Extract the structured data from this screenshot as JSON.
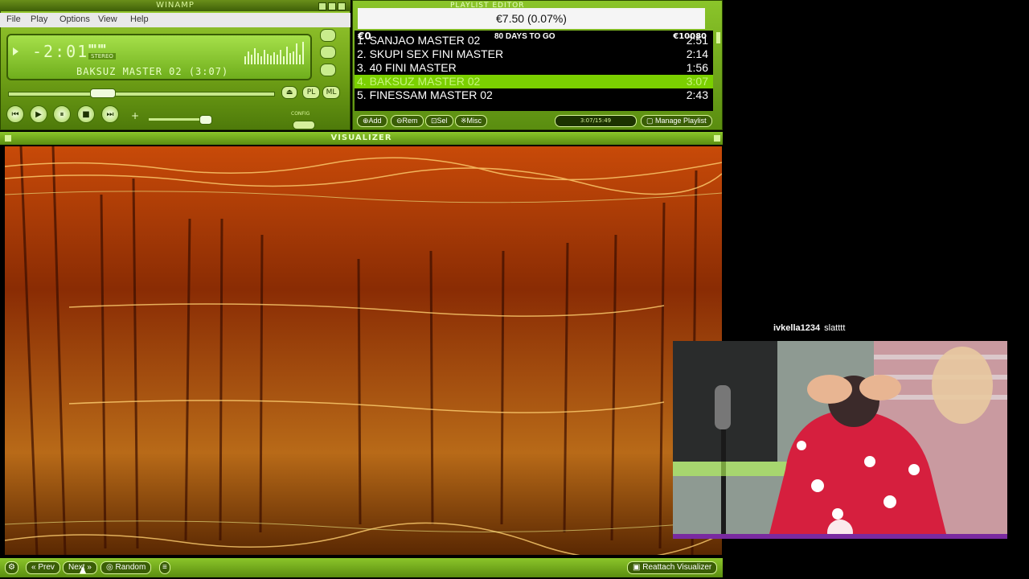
{
  "main_window": {
    "title": "WINAMP",
    "menu": [
      "File",
      "Play",
      "Options",
      "View",
      "Help"
    ],
    "time": "-2:01",
    "stereo": "STEREO",
    "now_playing": "BAKSUZ MASTER 02 (3:07)",
    "buttons": {
      "pl": "PL",
      "ml": "ML",
      "config": "CONFIG"
    }
  },
  "playlist": {
    "title": "PLAYLIST EDITOR",
    "donation": "€7.50 (0.07%)",
    "goal_left": "€0",
    "goal_text": "80 DAYS TO GO",
    "goal_target": "€10080",
    "tracks": [
      {
        "num": "1.",
        "name": "SANJAO MASTER 02",
        "dur": "2:51",
        "selected": false
      },
      {
        "num": "2.",
        "name": "SKUPI SEX FINI MASTER",
        "dur": "2:14",
        "selected": false
      },
      {
        "num": "3.",
        "name": "40 FINI MASTER",
        "dur": "1:56",
        "selected": false
      },
      {
        "num": "4.",
        "name": "BAKSUZ MASTER 02",
        "dur": "3:07",
        "selected": true
      },
      {
        "num": "5.",
        "name": "FINESSAM MASTER 02",
        "dur": "2:43",
        "selected": false
      }
    ],
    "buttons": {
      "add": "Add",
      "rem": "Rem",
      "sel": "Sel",
      "misc": "Misc",
      "manage": "Manage Playlist"
    },
    "total_time": "3:07/15:49"
  },
  "visualizer": {
    "title": "VISUALIZER",
    "buttons": {
      "prev": "Prev",
      "next": "Next",
      "random": "Random",
      "reattach": "Reattach Visualizer"
    }
  },
  "chat": {
    "user": "ivkella1234",
    "message": "slatttt"
  },
  "colors": {
    "accent": "#7bd000",
    "skin": "#8bc52a",
    "cam_border": "#7a2aa0"
  }
}
